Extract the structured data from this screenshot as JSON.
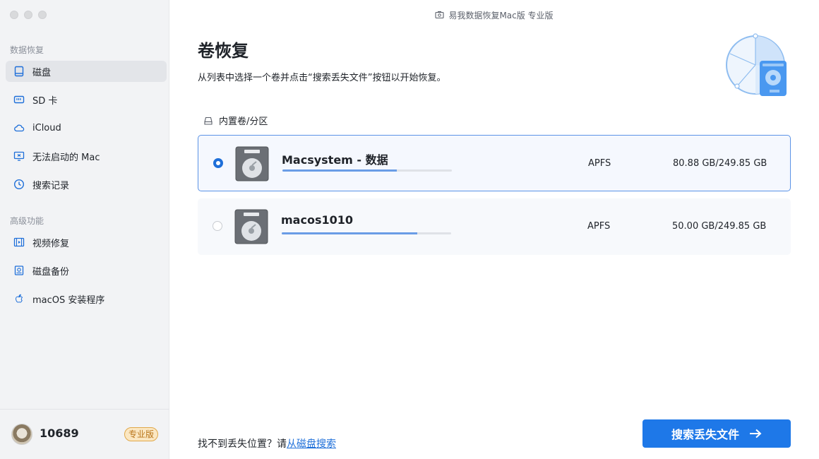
{
  "window": {
    "title": "易我数据恢复Mac版 专业版"
  },
  "sidebar": {
    "section1_title": "数据恢复",
    "section1_items": [
      {
        "label": "磁盘",
        "icon": "disk-icon",
        "active": true
      },
      {
        "label": "SD 卡",
        "icon": "sd-card-icon",
        "active": false
      },
      {
        "label": "iCloud",
        "icon": "cloud-icon",
        "active": false
      },
      {
        "label": "无法启动的 Mac",
        "icon": "monitor-icon",
        "active": false
      },
      {
        "label": "搜索记录",
        "icon": "clock-icon",
        "active": false
      }
    ],
    "section2_title": "高级功能",
    "section2_items": [
      {
        "label": "视频修复",
        "icon": "film-icon"
      },
      {
        "label": "磁盘备份",
        "icon": "backup-icon"
      },
      {
        "label": "macOS 安装程序",
        "icon": "apple-icon"
      }
    ]
  },
  "user": {
    "name": "10689",
    "badge": "专业版"
  },
  "main": {
    "title": "卷恢复",
    "description": "从列表中选择一个卷并点击“搜索丢失文件”按钮以开始恢复。",
    "list_header": "内置卷/分区",
    "volumes": [
      {
        "name": "Macsystem - 数据",
        "filesystem": "APFS",
        "size": "80.88 GB/249.85 GB",
        "usage": 0.675,
        "selected": true
      },
      {
        "name": "macos1010",
        "filesystem": "APFS",
        "size": "50.00 GB/249.85 GB",
        "usage": 0.8,
        "selected": false
      }
    ]
  },
  "footer": {
    "hint": "找不到丢失位置？请",
    "link": "从磁盘搜索",
    "scan_button": "搜索丢失文件"
  },
  "colors": {
    "accent": "#1e78e8",
    "badge": "#b9751a"
  }
}
